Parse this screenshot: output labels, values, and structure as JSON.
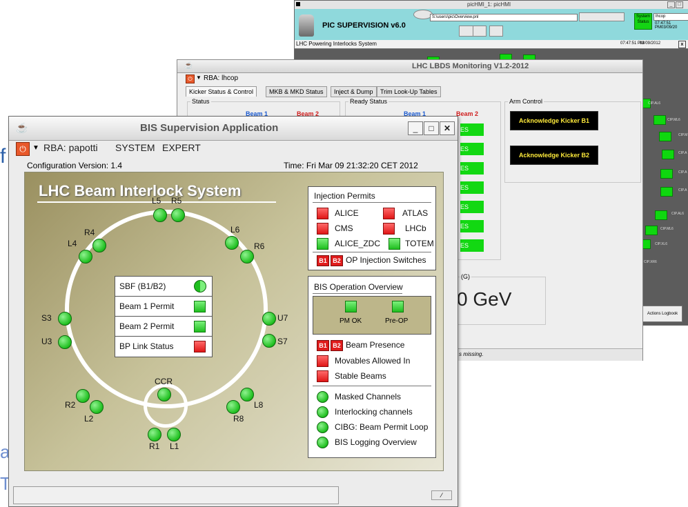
{
  "background_fragments": {
    "f": "f",
    "a": "a",
    "t": "T"
  },
  "pic": {
    "window_title": "picHMI_1: picHMI",
    "app_title": "PIC SUPERVISION v6.0",
    "path_value": "S:\\users\\pic\\Overview.pnl",
    "user_value": "lhcop",
    "system_status": "System Status",
    "datetime": "07:47:51 PM03/09/20",
    "subtitle": "LHC Powering Interlocks System",
    "sub_time": "07:47:51 PM",
    "sub_date": "03/09/2012",
    "actions_logbook": "Actions Logbook",
    "labels": [
      "CIP.AL6",
      "CIP.ML6",
      "CIP.M",
      "CIP.A",
      "CIP.A",
      "CIP.A",
      "CIP.AL6",
      "CIP.ML6",
      "CIP.XL6",
      "CIP.XR6"
    ]
  },
  "lbds": {
    "title": "LHC LBDS Monitoring V1.2-2012",
    "rba": "RBA: lhcop",
    "tabs": [
      "Kicker Status & Control",
      "MKB & MKD Status",
      "Inject & Dump",
      "Trim Look-Up Tables"
    ],
    "status_caption": "Status",
    "ready_caption": "Ready Status",
    "arm_caption": "Arm Control",
    "beam1": "Beam 1",
    "beam2": "Beam 2",
    "ack_b1": "Acknowledge Kicker B1",
    "ack_b2": "Acknowledge Kicker B2",
    "green_text": "ES",
    "energy_caption": "(G)",
    "energy_value": "0 GeV",
    "status_msg": "s missing."
  },
  "bis": {
    "title": "BIS Supervision Application",
    "rba": "RBA: papotti",
    "menu_system": "SYSTEM",
    "menu_expert": "EXPERT",
    "config_version": "Configuration Version:  1.4",
    "time": "Time:  Fri Mar 09 21:32:20 CET 2012",
    "panel_title": "LHC Beam Interlock System",
    "ring_labels": {
      "L5": "L5",
      "R5": "R5",
      "L6": "L6",
      "R6": "R6",
      "R4": "R4",
      "L4": "L4",
      "S3": "S3",
      "U3": "U3",
      "U7": "U7",
      "S7": "S7",
      "R2": "R2",
      "L2": "L2",
      "CCR": "CCR",
      "L8": "L8",
      "R8": "R8",
      "R1": "R1",
      "L1": "L1"
    },
    "permits": [
      {
        "label": "SBF (B1/B2)",
        "state": "split"
      },
      {
        "label": "Beam 1 Permit",
        "state": "green"
      },
      {
        "label": "Beam 2 Permit",
        "state": "green"
      },
      {
        "label": "BP Link Status",
        "state": "red"
      }
    ],
    "injection": {
      "title": "Injection Permits",
      "items": [
        {
          "label": "ALICE",
          "state": "red"
        },
        {
          "label": "ATLAS",
          "state": "red"
        },
        {
          "label": "CMS",
          "state": "red"
        },
        {
          "label": "LHCb",
          "state": "red"
        },
        {
          "label": "ALICE_ZDC",
          "state": "green"
        },
        {
          "label": "TOTEM",
          "state": "green"
        }
      ],
      "b1": "B1",
      "b2": "B2",
      "switches": "OP Injection Switches"
    },
    "overview": {
      "title": "BIS Operation Overview",
      "pm_ok": "PM OK",
      "pre_op": "Pre-OP",
      "beam_presence": "Beam Presence",
      "movables": "Movables Allowed In",
      "stable": "Stable Beams",
      "masked": "Masked Channels",
      "interlocking": "Interlocking channels",
      "cibg": "CIBG: Beam Permit Loop",
      "logging": "BIS Logging Overview"
    },
    "colors": {
      "green": "#1fbf1f",
      "red": "#e01616",
      "panel_dark": "#9a9060",
      "panel_light": "#e8e6d6"
    }
  }
}
